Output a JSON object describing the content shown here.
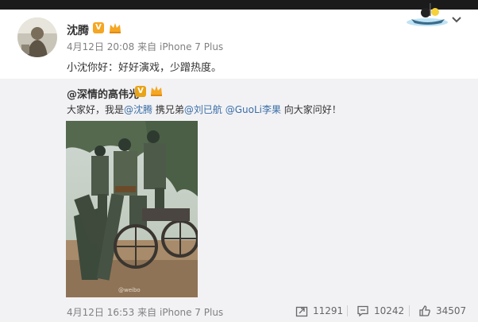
{
  "post": {
    "author": "沈腾",
    "badge": "V",
    "time": "4月12日 20:08",
    "via": "来自",
    "device": "iPhone 7 Plus",
    "text": "小沈你好：好好演戏，少蹭热度。"
  },
  "repost": {
    "author": "@深情的高伟光",
    "badge": "V",
    "text_prefix": "大家好，我是",
    "mention_1": "@沈腾",
    "text_mid_1": " 携兄弟",
    "mention_2": "@刘已航",
    "text_space": " ",
    "mention_3": "@GuoLi李果",
    "text_suffix": " 向大家问好！",
    "time": "4月12日 16:53",
    "via": "来自",
    "device": "iPhone 7 Plus",
    "repost_count": "11291",
    "comment_count": "10242",
    "like_count": "34507"
  },
  "icons": {
    "menu": "chevron-down-icon",
    "repost": "repost-icon",
    "comment": "comment-icon",
    "like": "like-icon"
  },
  "colors": {
    "link": "#3a6ea5",
    "badge": "#f5a623",
    "meta": "#808080",
    "repost_bg": "#f2f2f5"
  }
}
